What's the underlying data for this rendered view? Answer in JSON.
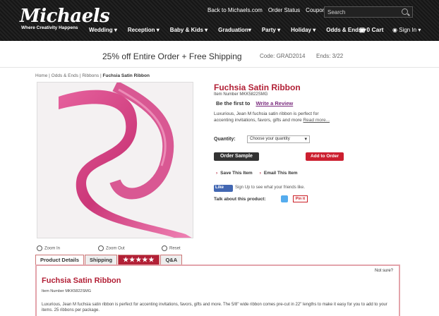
{
  "header": {
    "logo": "Michaels",
    "tagline": "Where Creativity Happens",
    "top_links": [
      "Back to Michaels.com",
      "Order Status",
      "Coupons"
    ],
    "search_placeholder": "Search",
    "nav": [
      "Wedding ▾",
      "Reception ▾",
      "Baby & Kids ▾",
      "Graduation▾",
      "Party ▾",
      "Holiday ▾",
      "Odds & Ends ▾"
    ],
    "cart": "0  Cart",
    "sign_in": "Sign In ▾"
  },
  "promo": {
    "main": "25% off Entire Order + Free Shipping",
    "code": "Code: GRAD2014",
    "ends": "Ends: 3/22"
  },
  "breadcrumb": {
    "home": "Home",
    "sep": "|",
    "odds": "Odds & Ends",
    "ribbons": "Ribbons",
    "current": "Fuchsia Satin Ribbon"
  },
  "product": {
    "title": "Fuchsia Satin Ribbon",
    "item_number": "Item Number MKK5822SMG",
    "review_prefix": "Be the first to",
    "review_link": "Write a Review",
    "description": "Luxurious, Jean M fuchsia satin ribbon is perfect for accenting invitations, favors, gifts and more",
    "read_more": "Read more...",
    "quantity_label": "Quantity:",
    "quantity_select": "Choose your quantity",
    "order_sample": "Order Sample",
    "add_to_order": "Add to Order",
    "save_item": "Save This Item",
    "email_item": "Email This Item",
    "fb_like": "Like",
    "fb_text": "Sign Up to see what your friends like.",
    "talk": "Talk about this product:",
    "pin": "Pin it"
  },
  "image_controls": {
    "zoom_in": "Zoom In",
    "zoom_out": "Zoom Out",
    "reset": "Reset"
  },
  "tabs": {
    "details": "Product Details",
    "shipping": "Shipping",
    "stars": "★★★★★",
    "qa": "Q&A"
  },
  "panel": {
    "not_sure": "Not sure?",
    "title": "Fuchsia Satin Ribbon",
    "item_number": "Item Number MKK5822SMG",
    "description": "Luxurious, Jean M fuchsia satin ribbon is perfect for accenting invitations, favors, gifts and more. The 5/8\" wide ribbon comes pre-cut in 22\" lengths to make it easy for you to add to your items. 25 ribbons per package."
  },
  "colors": {
    "accent": "#b22036",
    "add_button": "#cc1f2f",
    "ribbon": "#d63d82"
  }
}
